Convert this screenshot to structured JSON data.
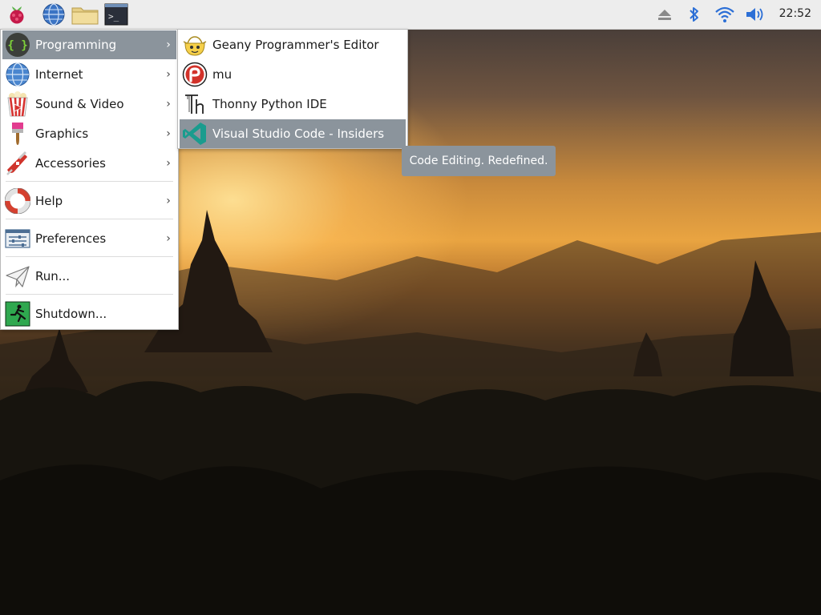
{
  "taskbar": {
    "launchers": [
      {
        "name": "raspberry-menu-icon"
      },
      {
        "name": "web-browser-icon"
      },
      {
        "name": "file-manager-icon"
      },
      {
        "name": "terminal-icon"
      }
    ],
    "tray": [
      "eject-icon",
      "bluetooth-icon",
      "wifi-icon",
      "volume-icon"
    ],
    "clock": "22:52"
  },
  "main_menu": {
    "items": [
      {
        "label": "Programming",
        "icon": "programming-icon",
        "submenu": true,
        "active": true
      },
      {
        "label": "Internet",
        "icon": "globe-icon",
        "submenu": true
      },
      {
        "label": "Sound & Video",
        "icon": "popcorn-icon",
        "submenu": true
      },
      {
        "label": "Graphics",
        "icon": "paintbrush-icon",
        "submenu": true
      },
      {
        "label": "Accessories",
        "icon": "pocketknife-icon",
        "submenu": true
      },
      {
        "label": "Help",
        "icon": "lifebuoy-icon",
        "submenu": true
      },
      {
        "label": "Preferences",
        "icon": "preferences-icon",
        "submenu": true
      },
      {
        "label": "Run...",
        "icon": "paper-plane-icon",
        "submenu": false
      },
      {
        "label": "Shutdown...",
        "icon": "exit-icon",
        "submenu": false
      }
    ]
  },
  "programming_menu": {
    "items": [
      {
        "label": "Geany Programmer's Editor",
        "icon": "geany-icon"
      },
      {
        "label": "mu",
        "icon": "mu-icon"
      },
      {
        "label": "Thonny Python IDE",
        "icon": "thonny-icon"
      },
      {
        "label": "Visual Studio Code - Insiders",
        "icon": "vscode-icon",
        "active": true
      }
    ]
  },
  "tooltip": {
    "text": "Code Editing. Redefined."
  },
  "colors": {
    "highlight": "#8b949c",
    "taskbar": "#ededed",
    "menu_bg": "#ffffff"
  }
}
